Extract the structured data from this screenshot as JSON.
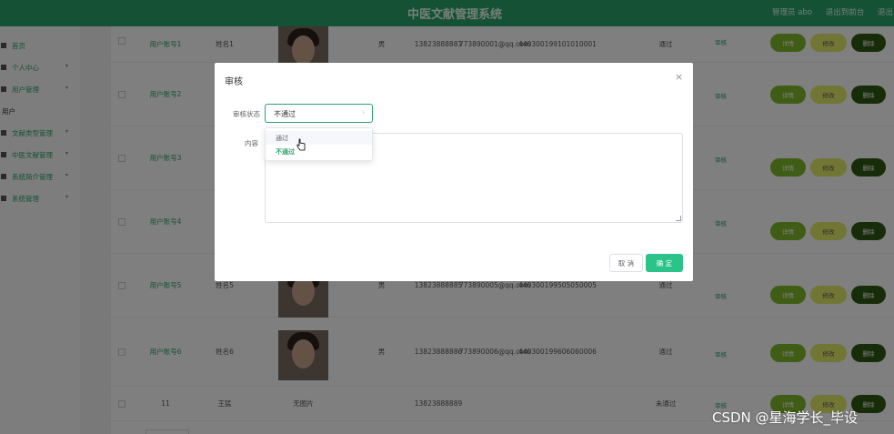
{
  "header": {
    "title": "中医文献管理系统",
    "admin_label": "管理员 abo",
    "back_label": "退出到前台",
    "logout_label": "退出"
  },
  "sidebar": {
    "items": [
      {
        "label": "首页"
      },
      {
        "label": "个人中心"
      },
      {
        "label": "用户管理"
      },
      {
        "label": "用户"
      },
      {
        "label": "文献类型管理"
      },
      {
        "label": "中医文献管理"
      },
      {
        "label": "系统简介管理"
      },
      {
        "label": "系统管理"
      }
    ]
  },
  "table": {
    "rows": [
      {
        "account": "用户账号1",
        "name": "姓名1",
        "gender": "男",
        "phone": "13823888881",
        "email": "773890001@qq.com",
        "id": "440300199101010001",
        "status": "通过"
      },
      {
        "account": "用户账号2",
        "name": "",
        "gender": "",
        "phone": "",
        "email": "",
        "id": "",
        "status": ""
      },
      {
        "account": "用户账号3",
        "name": "",
        "gender": "",
        "phone": "",
        "email": "",
        "id": "",
        "status": ""
      },
      {
        "account": "用户账号4",
        "name": "",
        "gender": "",
        "phone": "",
        "email": "",
        "id": "",
        "status": ""
      },
      {
        "account": "用户账号5",
        "name": "姓名5",
        "gender": "男",
        "phone": "13823888885",
        "email": "773890005@qq.com",
        "id": "440300199505050005",
        "status": "通过"
      },
      {
        "account": "用户账号6",
        "name": "姓名6",
        "gender": "男",
        "phone": "13823888886",
        "email": "773890006@qq.com",
        "id": "440300199606060006",
        "status": "通过"
      },
      {
        "account": "11",
        "name": "王猛",
        "photo_text": "无图片",
        "phone": "13823888889",
        "status": "未通过"
      }
    ],
    "actions": {
      "audit": "审核",
      "view": "详情",
      "edit": "修改",
      "delete": "删除"
    }
  },
  "modal": {
    "title": "审核",
    "close_icon": "×",
    "status_label": "审核状态",
    "status_value": "不通过",
    "content_label": "内容",
    "options": [
      "通过",
      "不通过"
    ],
    "cancel_label": "取 消",
    "confirm_label": "确 定",
    "accent": "#2aa36b"
  },
  "watermark": "CSDN @星海学长_毕设"
}
